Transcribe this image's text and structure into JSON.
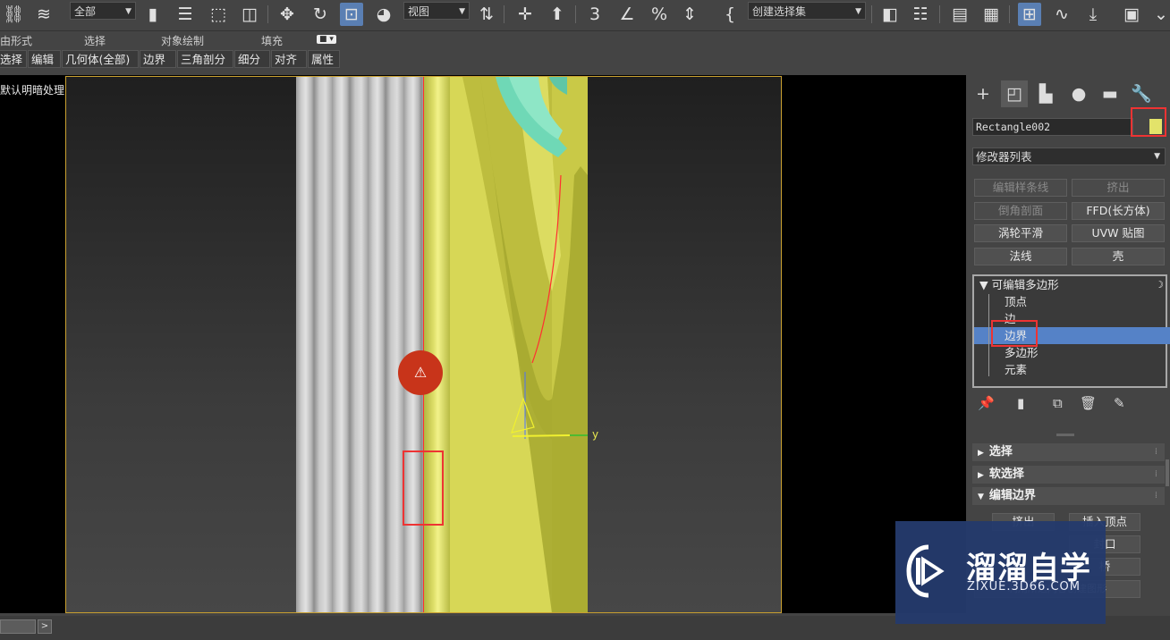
{
  "toolbar": {
    "filter_dropdown": "全部",
    "coord_dropdown": "视图",
    "selection_set_dropdown": "创建选择集"
  },
  "ribbon": {
    "items": [
      "由形式",
      "选择",
      "对象绘制",
      "填充"
    ]
  },
  "subtabs": [
    "选择",
    "编辑",
    "几何体(全部)",
    "边界",
    "三角剖分",
    "细分",
    "对齐",
    "属性"
  ],
  "viewport": {
    "label": "默认明暗处理 ]",
    "axis_label": "y"
  },
  "command_panel": {
    "object_name": "Rectangle002",
    "object_color": "#e3e36a",
    "modifier_list": "修改器列表",
    "modifier_buttons": [
      {
        "label": "编辑样条线",
        "enabled": false
      },
      {
        "label": "挤出",
        "enabled": false
      },
      {
        "label": "倒角剖面",
        "enabled": false
      },
      {
        "label": "FFD(长方体)",
        "enabled": true
      },
      {
        "label": "涡轮平滑",
        "enabled": true
      },
      {
        "label": "UVW 贴图",
        "enabled": true
      },
      {
        "label": "法线",
        "enabled": true
      },
      {
        "label": "壳",
        "enabled": true
      }
    ],
    "stack": {
      "root": "可编辑多边形",
      "items": [
        "顶点",
        "边",
        "边界",
        "多边形",
        "元素"
      ],
      "selected": "边界"
    },
    "rollouts": [
      "选择",
      "软选择",
      "编辑边界"
    ],
    "edit_border_buttons": [
      "挤出",
      "插入顶点",
      "封口",
      "桥",
      "连接",
      "利用所选内容创建图形"
    ]
  },
  "watermark": {
    "title": "溜溜自学",
    "url": "ZIXUE.3D66.COM"
  }
}
